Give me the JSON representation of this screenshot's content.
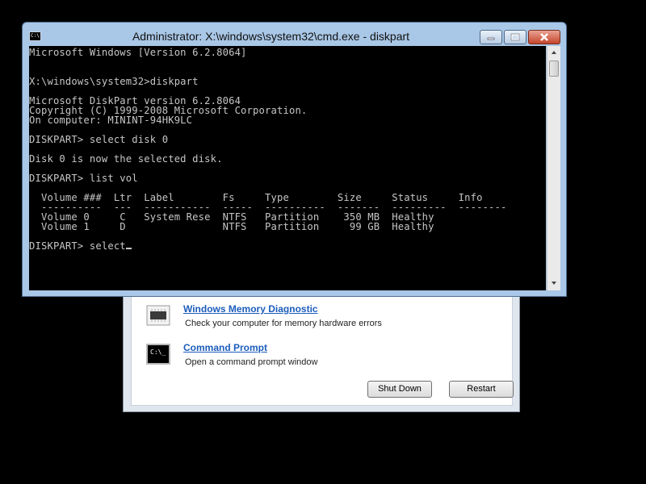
{
  "window": {
    "title": "Administrator: X:\\windows\\system32\\cmd.exe - diskpart",
    "icon_text": "C:\\",
    "controls": [
      "minimize",
      "maximize",
      "close"
    ]
  },
  "console": {
    "lines": [
      "Microsoft Windows [Version 6.2.8064]",
      "",
      "",
      "X:\\windows\\system32>diskpart",
      "",
      "Microsoft DiskPart version 6.2.8064",
      "Copyright (C) 1999-2008 Microsoft Corporation.",
      "On computer: MININT-94HK9LC",
      "",
      "DISKPART> select disk 0",
      "",
      "Disk 0 is now the selected disk.",
      "",
      "DISKPART> list vol",
      "",
      "  Volume ###  Ltr  Label        Fs     Type        Size     Status     Info",
      "  ----------  ---  -----------  -----  ----------  -------  ---------  --------",
      "  Volume 0     C   System Rese  NTFS   Partition    350 MB  Healthy",
      "  Volume 1     D                NTFS   Partition     99 GB  Healthy",
      "",
      "DISKPART> select"
    ]
  },
  "recovery": {
    "options": [
      {
        "title": "Windows Memory Diagnostic",
        "desc": "Check your computer for memory hardware errors",
        "icon": "memory-chip-icon"
      },
      {
        "title": "Command Prompt",
        "desc": "Open a command prompt window",
        "icon": "command-prompt-icon",
        "icon_text": "C:\\_"
      }
    ],
    "buttons": {
      "shutdown": "Shut Down",
      "restart": "Restart"
    }
  }
}
